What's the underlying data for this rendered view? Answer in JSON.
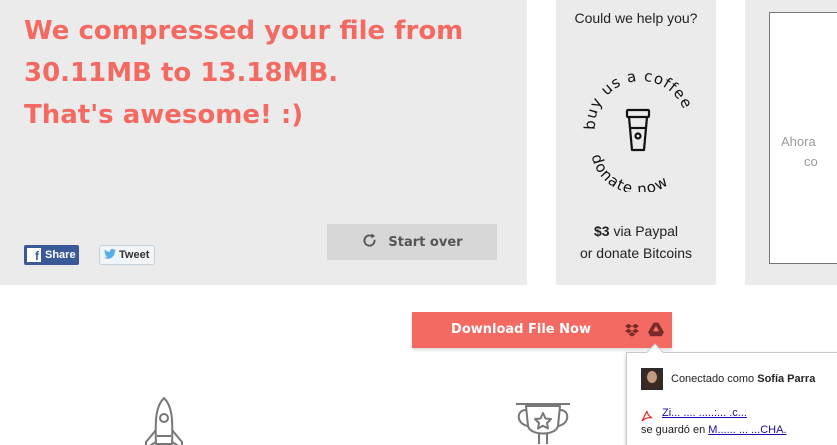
{
  "result": {
    "line1": "We compressed your file from",
    "line2": "30.11MB to 13.18MB.",
    "line3": "That's awesome! :)",
    "accent_color": "#f26a62"
  },
  "social": {
    "share_label": "Share",
    "tweet_label": "Tweet",
    "facebook_icon": "facebook-icon",
    "twitter_icon": "twitter-bird-icon"
  },
  "start_over": {
    "label": "Start over",
    "icon": "refresh-icon"
  },
  "coffee": {
    "title": "Could we help you?",
    "badge_top_text": "buy us a coffee",
    "badge_bottom_text": "donate now",
    "price": "$3",
    "via": "via Paypal",
    "alt": "or donate Bitcoins"
  },
  "right_panel": {
    "text1": "Ahora",
    "text2": "co"
  },
  "download": {
    "label": "Download File Now",
    "dropbox_icon": "dropbox-icon",
    "drive_icon": "google-drive-icon"
  },
  "drive_popup": {
    "connected_prefix": "Conectado como",
    "user_name": "Sofía Parra",
    "file_link": "Zi... .... .....:... .c...",
    "saved_prefix": "se guardó en",
    "saved_folder": "M...... ... ...CHA."
  },
  "features": {
    "icon1": "rocket-icon",
    "icon2": "trophy-icon"
  }
}
